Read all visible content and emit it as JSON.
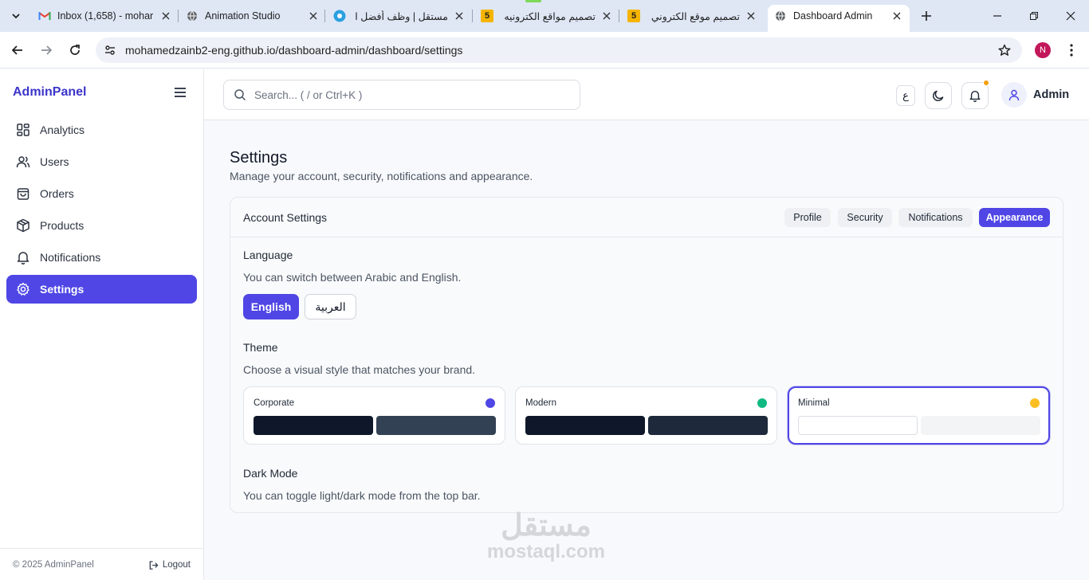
{
  "browser": {
    "tabs": [
      {
        "title": "Inbox (1,658) - mohar",
        "favicon": "gmail-icon"
      },
      {
        "title": "Animation Studio",
        "favicon": "globe-icon"
      },
      {
        "title": "مستقل | وظف أفضل ا",
        "favicon": "mostaql-icon"
      },
      {
        "title": "تصميم مواقع الكترونيه",
        "favicon": "html5-icon",
        "badge": "5"
      },
      {
        "title": "تصميم موقع الكتروني",
        "favicon": "html5-icon",
        "badge": "5"
      },
      {
        "title": "Dashboard Admin",
        "favicon": "globe-icon",
        "active": true
      }
    ],
    "url": "mohamedzainb2-eng.github.io/dashboard-admin/dashboard/settings",
    "profile_initial": "N"
  },
  "sidebar": {
    "brand": "AdminPanel",
    "items": [
      {
        "label": "Analytics",
        "icon": "grid-icon"
      },
      {
        "label": "Users",
        "icon": "users-icon"
      },
      {
        "label": "Orders",
        "icon": "bag-icon"
      },
      {
        "label": "Products",
        "icon": "box-icon"
      },
      {
        "label": "Notifications",
        "icon": "bell-icon"
      },
      {
        "label": "Settings",
        "icon": "gear-icon",
        "active": true
      }
    ],
    "footer": {
      "copyright": "© 2025 AdminPanel",
      "logout": "Logout"
    }
  },
  "topbar": {
    "search_placeholder": "Search... ( / or Ctrl+K )",
    "lang_toggle": "ع",
    "user_name": "Admin"
  },
  "page": {
    "title": "Settings",
    "subtitle": "Manage your account, security, notifications and appearance."
  },
  "card": {
    "title": "Account Settings",
    "tabs": [
      {
        "label": "Profile"
      },
      {
        "label": "Security"
      },
      {
        "label": "Notifications"
      },
      {
        "label": "Appearance",
        "active": true
      }
    ],
    "language": {
      "title": "Language",
      "description": "You can switch between Arabic and English.",
      "options": [
        {
          "label": "English",
          "selected": true
        },
        {
          "label": "العربية"
        }
      ]
    },
    "theme": {
      "title": "Theme",
      "description": "Choose a visual style that matches your brand.",
      "options": [
        {
          "name": "Corporate",
          "dot": "#4f46e5",
          "swatches": [
            "#0f172a",
            "#334155"
          ]
        },
        {
          "name": "Modern",
          "dot": "#10b981",
          "swatches": [
            "#0f172a",
            "#1e293b"
          ]
        },
        {
          "name": "Minimal",
          "dot": "#fbbf24",
          "swatches": [
            "#ffffff",
            "#f3f4f6"
          ],
          "selected": true
        }
      ]
    },
    "dark_mode": {
      "title": "Dark Mode",
      "description": "You can toggle light/dark mode from the top bar."
    }
  },
  "watermark": {
    "arabic": "مستقل",
    "latin": "mostaql.com"
  },
  "colors": {
    "accent": "#4f46e5",
    "brand_text": "#3b35c9",
    "notification_dot": "#f59e0b"
  }
}
